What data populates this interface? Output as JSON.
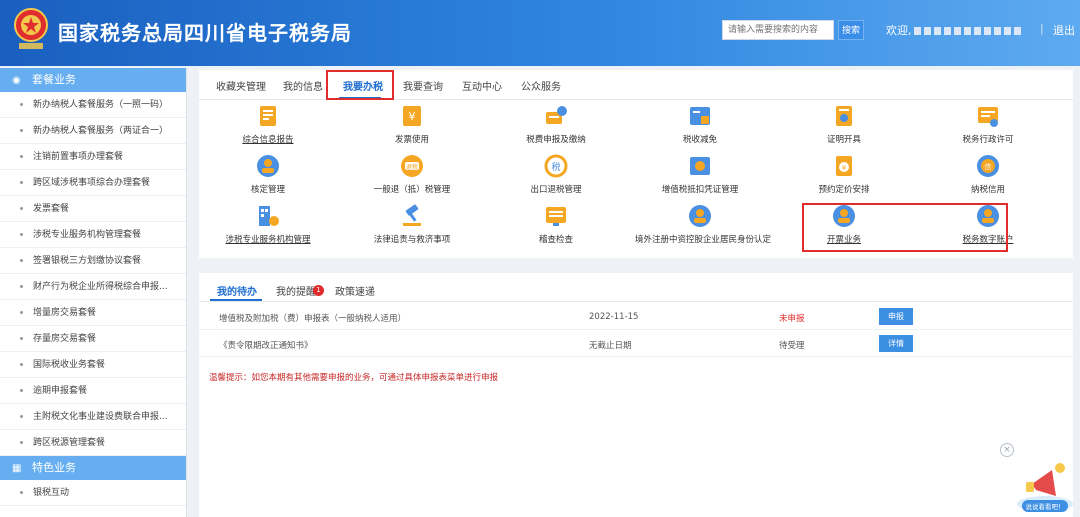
{
  "header": {
    "title": "国家税务总局四川省电子税务局",
    "search_placeholder": "请输入需要搜索的内容",
    "search_label": "搜索",
    "welcome": "欢迎,",
    "separator": "|",
    "logout": "退出"
  },
  "sidebar": {
    "group1": "套餐业务",
    "items": [
      "新办纳税人套餐服务（一照一码）",
      "新办纳税人套餐服务（两证合一）",
      "注销前置事项办理套餐",
      "跨区域涉税事项综合办理套餐",
      "发票套餐",
      "涉税专业服务机构管理套餐",
      "签署银税三方划缴协议套餐",
      "财产行为税企业所得税综合申报...",
      "增量房交易套餐",
      "存量房交易套餐",
      "国际税收业务套餐",
      "逾期申报套餐",
      "主附税文化事业建设费联合申报...",
      "跨区税源管理套餐"
    ],
    "group2": "特色业务",
    "items2": [
      "银税互动"
    ]
  },
  "tabs": [
    "收藏夹管理",
    "我的信息",
    "我要办税",
    "我要查询",
    "互动中心",
    "公众服务"
  ],
  "services": [
    {
      "label": "综合信息报告",
      "icon": "report-icon",
      "underline": true
    },
    {
      "label": "发票使用",
      "icon": "invoice-icon",
      "underline": false
    },
    {
      "label": "税费申报及缴纳",
      "icon": "tax-declare-icon",
      "underline": false
    },
    {
      "label": "税收减免",
      "icon": "tax-reduction-icon",
      "underline": false
    },
    {
      "label": "证明开具",
      "icon": "certificate-icon",
      "underline": false
    },
    {
      "label": "税务行政许可",
      "icon": "permit-icon",
      "underline": false
    },
    {
      "label": "核定管理",
      "icon": "verify-icon",
      "underline": false
    },
    {
      "label": "一般退（抵）税管理",
      "icon": "refund-icon",
      "underline": false
    },
    {
      "label": "出口退税管理",
      "icon": "export-refund-icon",
      "underline": false
    },
    {
      "label": "增值税抵扣凭证管理",
      "icon": "vat-deduction-icon",
      "underline": false
    },
    {
      "label": "预约定价安排",
      "icon": "pricing-icon",
      "underline": false
    },
    {
      "label": "纳税信用",
      "icon": "credit-icon",
      "underline": false
    },
    {
      "label": "涉税专业服务机构管理",
      "icon": "agency-icon",
      "underline": true
    },
    {
      "label": "法律追责与救济事项",
      "icon": "law-icon",
      "underline": false
    },
    {
      "label": "稽查检查",
      "icon": "inspection-icon",
      "underline": false
    },
    {
      "label": "境外注册中资控股企业居民身份认定",
      "icon": "resident-icon",
      "underline": false
    },
    {
      "label": "开票业务",
      "icon": "billing-icon",
      "underline": true
    },
    {
      "label": "税务数字账户",
      "icon": "digital-account-icon",
      "underline": true
    }
  ],
  "todo_tabs": [
    "我的待办",
    "我的提醒",
    "政策速递"
  ],
  "reminder_count": "1",
  "todo_rows": [
    {
      "title": "增值税及附加税（费）申报表（一般纳税人适用）",
      "date": "2022-11-15",
      "status": "未申报",
      "action": "申报"
    },
    {
      "title": "《责令限期改正通知书》",
      "date": "无截止日期",
      "status": "待受理",
      "action": "详情"
    }
  ],
  "tip": "温馨提示：如您本期有其他需要申报的业务，可通过具体申报表菜单进行申报",
  "widget_label": "说说看看吧！",
  "colors": {
    "primary": "#1f6fd1",
    "header": "#2f86e0",
    "highlight": "#e02d2d",
    "icon": "#f5a623"
  }
}
